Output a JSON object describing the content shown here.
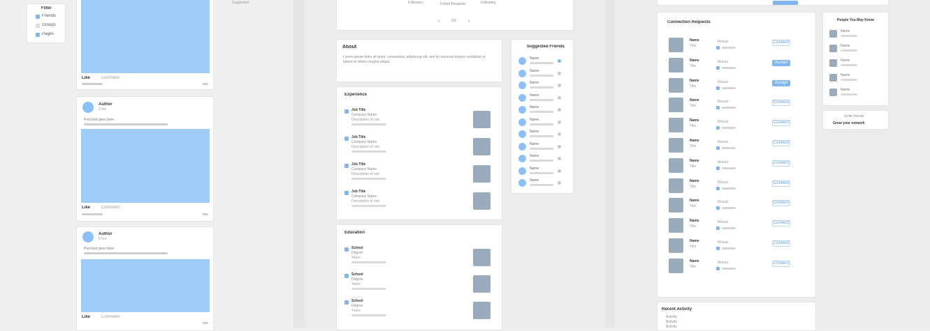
{
  "feed": {
    "filter_box": {
      "title": "Filter",
      "options": [
        "Friends",
        "Groups",
        "Pages"
      ]
    },
    "posts": [
      {
        "author": "",
        "meta": "",
        "text": "",
        "footer_a": "Like",
        "footer_b": "Comment"
      },
      {
        "author": "Author",
        "meta": "2 hrs",
        "text": "Post text goes here",
        "footer_a": "Like",
        "footer_b": "Comment"
      },
      {
        "author": "Author",
        "meta": "5 hrs",
        "text": "Post text goes here",
        "footer_a": "Like",
        "footer_b": "Comment"
      }
    ],
    "side_caption": "Suggested"
  },
  "profile": {
    "top_stats": [
      "Followers",
      "Friend Requests",
      "Following"
    ],
    "pagination": {
      "prev": "‹",
      "page": "1/2",
      "next": "›"
    },
    "about": {
      "title": "About",
      "text": "Lorem ipsum dolor sit amet, consectetur adipiscing elit, sed do eiusmod tempor incididunt ut labore et dolore magna aliqua."
    },
    "suggested_friends": {
      "title": "Suggested Friends",
      "items": [
        "Name",
        "Name",
        "Name",
        "Name",
        "Name",
        "Name",
        "Name",
        "Name",
        "Name",
        "Name",
        "Name"
      ]
    },
    "experience": {
      "title": "Experience",
      "items": [
        {
          "title": "Job Title",
          "org": "Company Name",
          "desc": "Description of role"
        },
        {
          "title": "Job Title",
          "org": "Company Name",
          "desc": "Description of role"
        },
        {
          "title": "Job Title",
          "org": "Company Name",
          "desc": "Description of role"
        },
        {
          "title": "Job Title",
          "org": "Company Name",
          "desc": "Description of role"
        }
      ]
    },
    "education": {
      "title": "Education",
      "items": [
        {
          "title": "School",
          "org": "Degree",
          "desc": "Years"
        },
        {
          "title": "School",
          "org": "Degree",
          "desc": "Years"
        },
        {
          "title": "School",
          "org": "Degree",
          "desc": "Years"
        }
      ]
    }
  },
  "connections": {
    "list_title": "Connection Requests",
    "rows": [
      {
        "name": "Name",
        "sub": "Title",
        "mutual": "Mutual",
        "action": "Connect",
        "filled": false
      },
      {
        "name": "Name",
        "sub": "Title",
        "mutual": "Mutual",
        "action": "Accept",
        "filled": true
      },
      {
        "name": "Name",
        "sub": "Title",
        "mutual": "Mutual",
        "action": "Accept",
        "filled": true
      },
      {
        "name": "Name",
        "sub": "Title",
        "mutual": "Mutual",
        "action": "Connect",
        "filled": false
      },
      {
        "name": "Name",
        "sub": "Title",
        "mutual": "Mutual",
        "action": "Connect",
        "filled": false
      },
      {
        "name": "Name",
        "sub": "Title",
        "mutual": "Mutual",
        "action": "Connect",
        "filled": false
      },
      {
        "name": "Name",
        "sub": "Title",
        "mutual": "Mutual",
        "action": "Connect",
        "filled": false
      },
      {
        "name": "Name",
        "sub": "Title",
        "mutual": "Mutual",
        "action": "Connect",
        "filled": false
      },
      {
        "name": "Name",
        "sub": "Title",
        "mutual": "Mutual",
        "action": "Connect",
        "filled": false
      },
      {
        "name": "Name",
        "sub": "Title",
        "mutual": "Mutual",
        "action": "Connect",
        "filled": false
      },
      {
        "name": "Name",
        "sub": "Title",
        "mutual": "Mutual",
        "action": "Connect",
        "filled": false
      },
      {
        "name": "Name",
        "sub": "Title",
        "mutual": "Mutual",
        "action": "Connect",
        "filled": false
      }
    ],
    "side_box": {
      "title": "People You May Know",
      "items": [
        "Name",
        "Name",
        "Name",
        "Name",
        "Name"
      ]
    },
    "side_link": {
      "title": "Invite friends",
      "sub": "Grow your network"
    },
    "bottom_box": {
      "title": "Recent Activity",
      "items": [
        "Activity",
        "Activity",
        "Activity"
      ]
    }
  }
}
